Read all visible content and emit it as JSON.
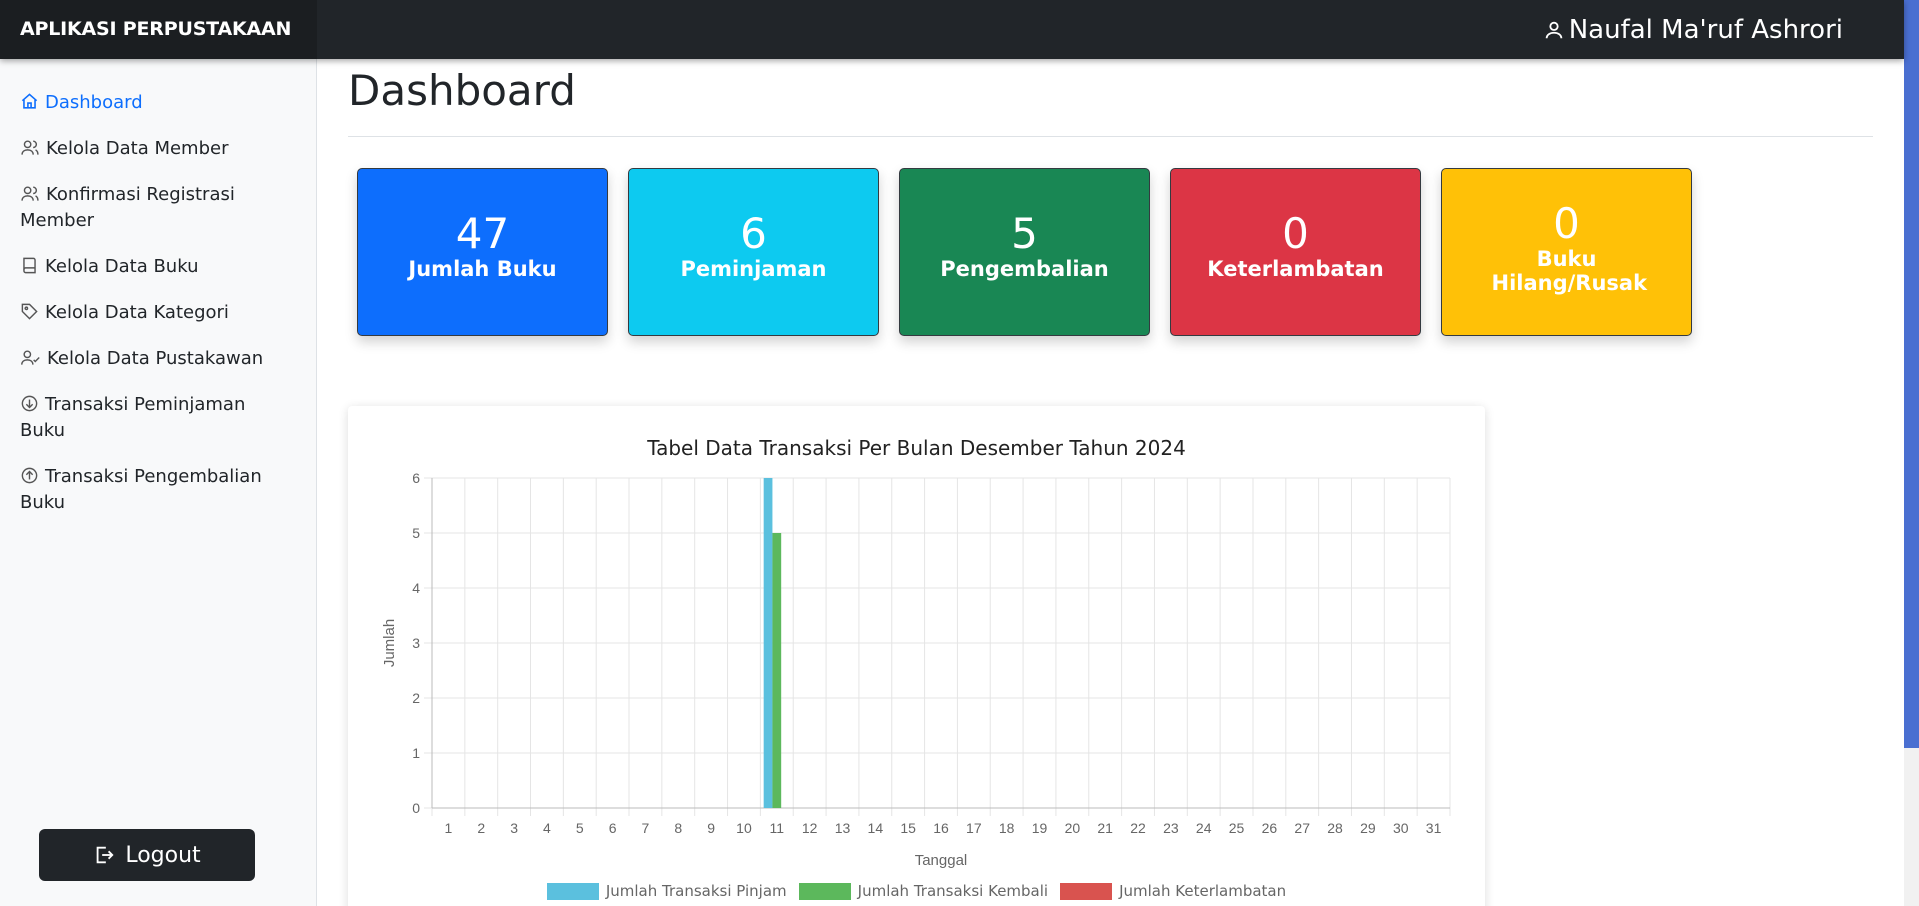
{
  "app": {
    "brand": "APLIKASI PERPUSTAKAAN",
    "user_name": "Naufal Ma'ruf Ashrori"
  },
  "sidebar": {
    "items": [
      {
        "label": "Dashboard",
        "icon": "home-icon",
        "active": true
      },
      {
        "label": "Kelola Data Member",
        "icon": "users-icon"
      },
      {
        "label": "Konfirmasi Registrasi Member",
        "icon": "users-icon"
      },
      {
        "label": "Kelola Data Buku",
        "icon": "book-icon"
      },
      {
        "label": "Kelola Data Kategori",
        "icon": "tag-icon"
      },
      {
        "label": "Kelola Data Pustakawan",
        "icon": "user-check-icon"
      },
      {
        "label": "Transaksi Peminjaman Buku",
        "icon": "arrow-down-circle-icon"
      },
      {
        "label": "Transaksi Pengembalian Buku",
        "icon": "arrow-up-circle-icon"
      }
    ],
    "logout_label": "Logout"
  },
  "main": {
    "title": "Dashboard"
  },
  "cards": [
    {
      "value": "47",
      "label": "Jumlah Buku",
      "color": "#0d6efd"
    },
    {
      "value": "6",
      "label": "Peminjaman",
      "color": "#0dcaf0"
    },
    {
      "value": "5",
      "label": "Pengembalian",
      "color": "#198754"
    },
    {
      "value": "0",
      "label": "Keterlambatan",
      "color": "#dc3545"
    },
    {
      "value": "0",
      "label": "Buku Hilang/Rusak",
      "color": "#ffc107"
    }
  ],
  "chart_data": {
    "type": "bar",
    "title": "Tabel Data Transaksi Per Bulan Desember Tahun 2024",
    "xlabel": "Tanggal",
    "ylabel": "Jumlah",
    "ylim": [
      0,
      6
    ],
    "yticks": [
      "0",
      "1",
      "2",
      "3",
      "4",
      "5",
      "6"
    ],
    "categories": [
      "1",
      "2",
      "3",
      "4",
      "5",
      "6",
      "7",
      "8",
      "9",
      "10",
      "11",
      "12",
      "13",
      "14",
      "15",
      "16",
      "17",
      "18",
      "19",
      "20",
      "21",
      "22",
      "23",
      "24",
      "25",
      "26",
      "27",
      "28",
      "29",
      "30",
      "31"
    ],
    "series": [
      {
        "name": "Jumlah Transaksi Pinjam",
        "color": "#5bc0de",
        "values": [
          0,
          0,
          0,
          0,
          0,
          0,
          0,
          0,
          0,
          0,
          6,
          0,
          0,
          0,
          0,
          0,
          0,
          0,
          0,
          0,
          0,
          0,
          0,
          0,
          0,
          0,
          0,
          0,
          0,
          0,
          0
        ]
      },
      {
        "name": "Jumlah Transaksi Kembali",
        "color": "#5cb85c",
        "values": [
          0,
          0,
          0,
          0,
          0,
          0,
          0,
          0,
          0,
          0,
          5,
          0,
          0,
          0,
          0,
          0,
          0,
          0,
          0,
          0,
          0,
          0,
          0,
          0,
          0,
          0,
          0,
          0,
          0,
          0,
          0
        ]
      },
      {
        "name": "Jumlah Keterlambatan",
        "color": "#d9534f",
        "values": [
          0,
          0,
          0,
          0,
          0,
          0,
          0,
          0,
          0,
          0,
          0,
          0,
          0,
          0,
          0,
          0,
          0,
          0,
          0,
          0,
          0,
          0,
          0,
          0,
          0,
          0,
          0,
          0,
          0,
          0,
          0
        ]
      }
    ],
    "grid": true,
    "legend": "bottom"
  }
}
